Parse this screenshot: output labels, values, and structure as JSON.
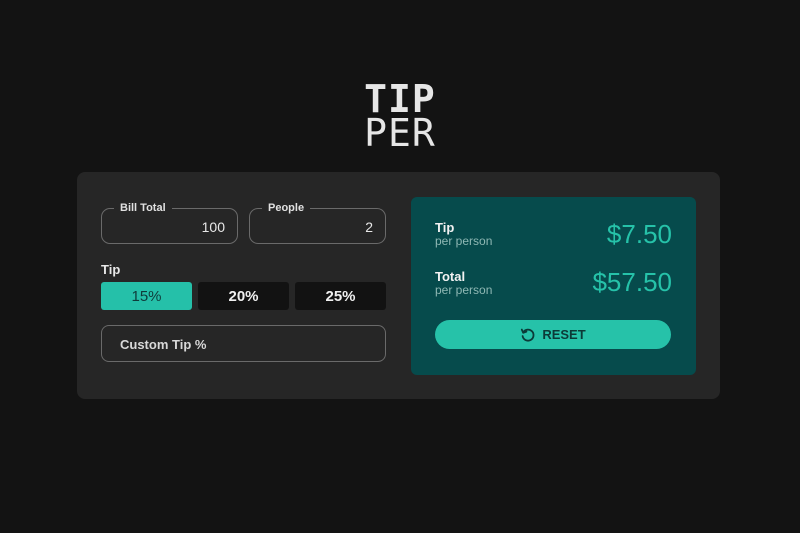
{
  "logo": {
    "line1": "TIP",
    "line2": "PER"
  },
  "form": {
    "bill": {
      "label": "Bill Total",
      "value": "100"
    },
    "people": {
      "label": "People",
      "value": "2"
    },
    "tip_label": "Tip",
    "tip_options": [
      "15%",
      "20%",
      "25%"
    ],
    "selected_tip": "15%",
    "custom_placeholder": "Custom Tip %"
  },
  "results": {
    "tip": {
      "label": "Tip",
      "sub": "per person",
      "amount": "$7.50"
    },
    "total": {
      "label": "Total",
      "sub": "per person",
      "amount": "$57.50"
    },
    "reset_label": "RESET"
  },
  "colors": {
    "background": "#131313",
    "card": "#262626",
    "accent": "#26c2a9",
    "result_panel": "#064b4c"
  },
  "icons": {
    "reset": "reset-icon"
  }
}
